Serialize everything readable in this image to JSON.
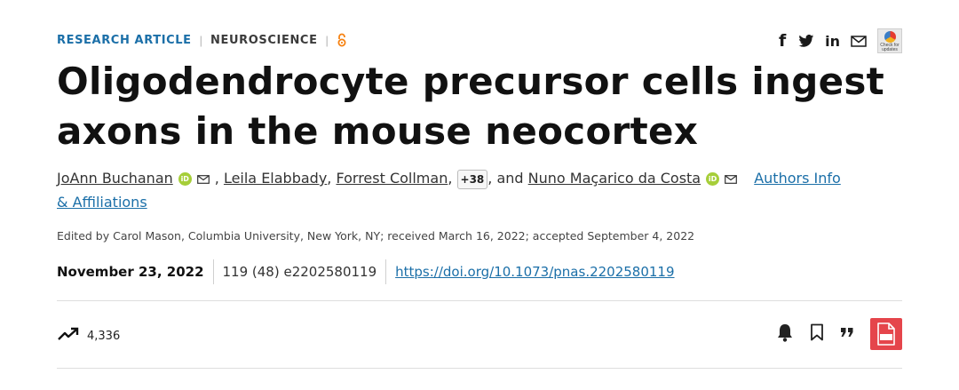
{
  "header": {
    "article_type": "RESEARCH ARTICLE",
    "subject": "NEUROSCIENCE",
    "open_access_icon": "open-access-icon"
  },
  "share": {
    "icons": [
      "facebook-icon",
      "twitter-icon",
      "linkedin-icon",
      "email-icon"
    ],
    "check_badge_text": "Check for updates"
  },
  "title_text": "Oligodendrocyte precursor cells ingest axons in the mouse neocortex",
  "authors": {
    "author1": "JoAnn Buchanan",
    "author2": "Leila Elabbady",
    "author3": "Forrest Collman",
    "more_count": "+38",
    "conj": ", and",
    "author_last": "Nuno Maçarico da Costa",
    "info_link": "Authors Info & Affiliations",
    "orcid_label": "iD"
  },
  "edited": "Edited by Carol Mason, Columbia University, New York, NY; received March 16, 2022; accepted September 4, 2022",
  "publication": {
    "date": "November 23, 2022",
    "citation": "119 (48) e2202580119",
    "doi": "https://doi.org/10.1073/pnas.2202580119"
  },
  "metrics": {
    "views": "4,336",
    "icon": "trending-up-icon"
  },
  "actions": {
    "icons": [
      "bell-icon",
      "bookmark-icon",
      "cite-quote-icon",
      "pdf-icon"
    ],
    "pdf_label": "PDF"
  },
  "colors": {
    "accent": "#1b6fa8",
    "orcid": "#a6ce39",
    "open_access": "#f68212",
    "pdf": "#e5454b"
  }
}
